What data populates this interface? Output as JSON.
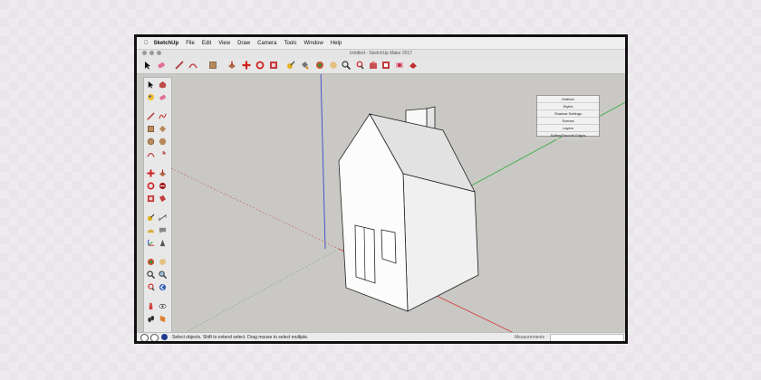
{
  "menubar": {
    "apple": "",
    "app": "SketchUp",
    "items": [
      "File",
      "Edit",
      "View",
      "Draw",
      "Camera",
      "Tools",
      "Window",
      "Help"
    ]
  },
  "window": {
    "title": "Untitled - SketchUp Make 2017"
  },
  "tray_panel": {
    "items": [
      "Outliner",
      "Styles",
      "Shadow Settings",
      "Scenes",
      "Layers",
      "Soften/Smooth Edges"
    ]
  },
  "status": {
    "message": "Select objects. Shift to extend select. Drag mouse to select multiple.",
    "measurements_label": "Measurements",
    "measurements_value": ""
  },
  "icons": {
    "toolbar": [
      "select-icon",
      "eraser-icon",
      "line-icon",
      "arc-icon",
      "shape-icon",
      "push-pull-icon",
      "move-icon",
      "rotate-icon",
      "scale-icon",
      "tape-measure-icon",
      "paint-bucket-icon",
      "orbit-icon",
      "pan-icon",
      "zoom-icon",
      "zoom-extents-icon",
      "3d-warehouse-icon",
      "extension-warehouse-icon",
      "send-to-layout-icon",
      "extension-manager-icon"
    ],
    "left": [
      "select-icon",
      "component-icon",
      "paint-icon",
      "eraser-icon",
      "line-icon",
      "freehand-icon",
      "rectangle-icon",
      "rotated-rectangle-icon",
      "circle-icon",
      "polygon-icon",
      "arc-icon",
      "pie-icon",
      "move-icon",
      "push-pull-icon",
      "rotate-icon",
      "follow-me-icon",
      "scale-icon",
      "offset-icon",
      "tape-measure-icon",
      "dimension-icon",
      "protractor-icon",
      "text-icon",
      "axes-icon",
      "3d-text-icon",
      "orbit-icon",
      "pan-icon",
      "zoom-icon",
      "zoom-window-icon",
      "zoom-extents-icon",
      "previous-icon",
      "position-camera-icon",
      "look-around-icon",
      "walk-icon",
      "section-plane-icon"
    ]
  },
  "colors": {
    "axis_red": "#d04545",
    "axis_green": "#3fae49",
    "axis_blue": "#3b49c8",
    "viewport_bg": "#c9c8c4"
  }
}
